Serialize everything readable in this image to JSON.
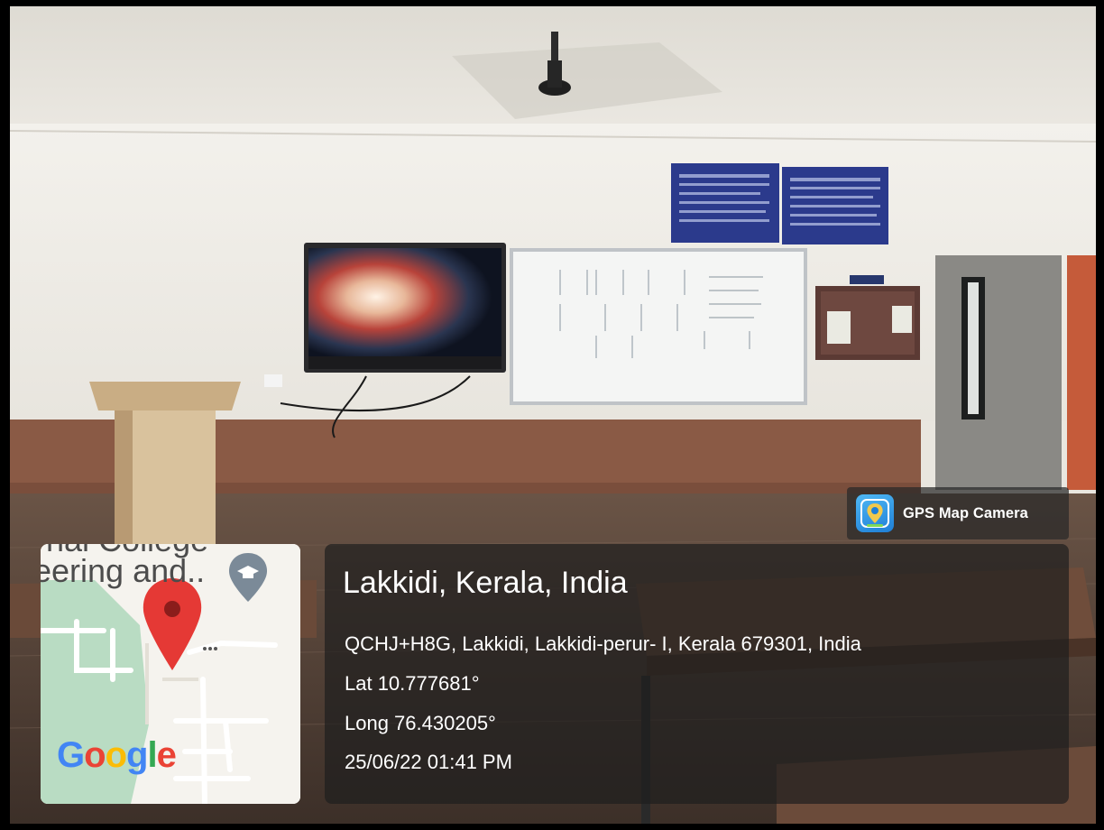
{
  "brand": {
    "name": "GPS Map Camera",
    "icon": "map-pin-camera-icon"
  },
  "map": {
    "label_top": "nal College",
    "label_main": "eering and..",
    "pin_icon": "location-pin-icon",
    "poi_icon": "graduation-cap-icon",
    "logo_letters": [
      "G",
      "o",
      "o",
      "g",
      "l",
      "e"
    ],
    "logo_colors": [
      "#4285f4",
      "#ea4335",
      "#fbbc05",
      "#4285f4",
      "#34a853",
      "#ea4335"
    ],
    "pin_color": "#e53935",
    "green_area_color": "#b9dcc3"
  },
  "location": {
    "title": "Lakkidi, Kerala, India",
    "address": "QCHJ+H8G, Lakkidi, Lakkidi-perur- I, Kerala 679301, India",
    "latitude": "Lat 10.777681°",
    "longitude": "Long 76.430205°",
    "timestamp": "25/06/22 01:41 PM"
  }
}
